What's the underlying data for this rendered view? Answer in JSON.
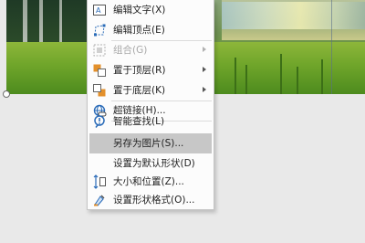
{
  "menu": {
    "items": [
      {
        "label": "编辑文字(X)",
        "icon": "text-box-icon",
        "enabled": true,
        "submenu": false
      },
      {
        "label": "编辑顶点(E)",
        "icon": "edit-points-icon",
        "enabled": true,
        "submenu": false
      },
      {
        "label": "组合(G)",
        "icon": "group-icon",
        "enabled": false,
        "submenu": true
      },
      {
        "label": "置于顶层(R)",
        "icon": "bring-to-front-icon",
        "enabled": true,
        "submenu": true
      },
      {
        "label": "置于底层(K)",
        "icon": "send-to-back-icon",
        "enabled": true,
        "submenu": true
      },
      {
        "label": "超链接(H)...",
        "icon": "hyperlink-icon",
        "enabled": true,
        "submenu": false
      },
      {
        "label": "智能查找(L)",
        "icon": "smart-lookup-icon",
        "enabled": true,
        "submenu": false
      },
      {
        "label": "另存为图片(S)...",
        "icon": "",
        "enabled": true,
        "submenu": false
      },
      {
        "label": "设置为默认形状(D)",
        "icon": "",
        "enabled": true,
        "submenu": false
      },
      {
        "label": "大小和位置(Z)...",
        "icon": "size-position-icon",
        "enabled": true,
        "submenu": false
      },
      {
        "label": "设置形状格式(O)...",
        "icon": "format-shape-icon",
        "enabled": true,
        "submenu": false
      }
    ],
    "highlighted_item": "另存为图片(S)..."
  },
  "colors": {
    "menu_background": "#fcfcfc",
    "menu_border": "#c6c6c6",
    "highlight": "#c7c7c7",
    "disabled_text": "#a8a8a8",
    "icon_blue": "#2a6bb8"
  }
}
